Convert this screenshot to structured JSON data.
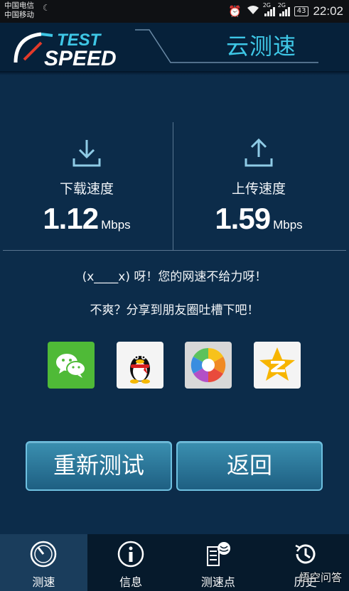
{
  "status_bar": {
    "carrier_1": "中国电信",
    "carrier_2": "中国移动",
    "net_label_1": "2G",
    "net_label_2": "2G",
    "battery": "43",
    "time": "22:02"
  },
  "header": {
    "logo_line1": "TEST",
    "logo_line2": "SPEED",
    "title": "云测速",
    "accent_color": "#3ec7e6"
  },
  "download": {
    "label": "下载速度",
    "value": "1.12",
    "unit": "Mbps",
    "icon": "download-icon"
  },
  "upload": {
    "label": "上传速度",
    "value": "1.59",
    "unit": "Mbps",
    "icon": "upload-icon"
  },
  "messages": {
    "line1": "(x____x) 呀！您的网速不给力呀！",
    "line2": "不爽？分享到朋友圈吐槽下吧！"
  },
  "share_targets": [
    "wechat-icon",
    "qq-icon",
    "photos-icon",
    "qzone-icon"
  ],
  "buttons": {
    "retest": "重新测试",
    "back": "返回"
  },
  "nav": [
    {
      "label": "测速",
      "icon": "speedometer-icon",
      "active": true
    },
    {
      "label": "信息",
      "icon": "info-icon",
      "active": false
    },
    {
      "label": "测速点",
      "icon": "globe-server-icon",
      "active": false
    },
    {
      "label": "历史",
      "icon": "history-icon",
      "active": false
    }
  ],
  "watermark": "悟空问答"
}
